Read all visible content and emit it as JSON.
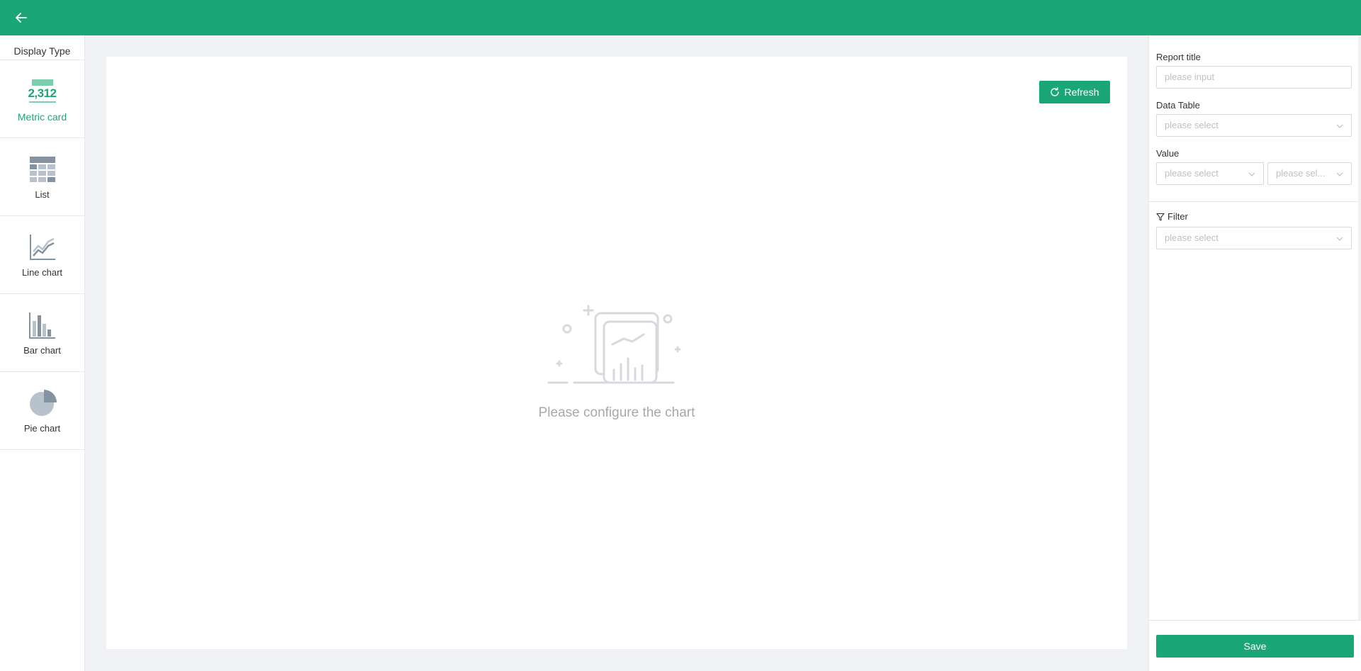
{
  "sidebar": {
    "title": "Display Type",
    "items": [
      {
        "label": "Metric card",
        "active": true,
        "sample_value": "2,312"
      },
      {
        "label": "List"
      },
      {
        "label": "Line chart"
      },
      {
        "label": "Bar chart"
      },
      {
        "label": "Pie chart"
      }
    ]
  },
  "canvas": {
    "refresh_label": "Refresh",
    "empty_text": "Please configure the chart"
  },
  "panel": {
    "report_title_label": "Report title",
    "report_title_placeholder": "please input",
    "data_table_label": "Data Table",
    "data_table_placeholder": "please select",
    "value_label": "Value",
    "value_field_placeholder": "please select",
    "value_agg_placeholder": "please sel...",
    "filter_label": "Filter",
    "filter_placeholder": "please select",
    "save_label": "Save"
  },
  "colors": {
    "brand": "#1ba678",
    "brand_light": "#7ccfae",
    "icon_gray": "#8593a0",
    "icon_light": "#b8c2cc"
  }
}
